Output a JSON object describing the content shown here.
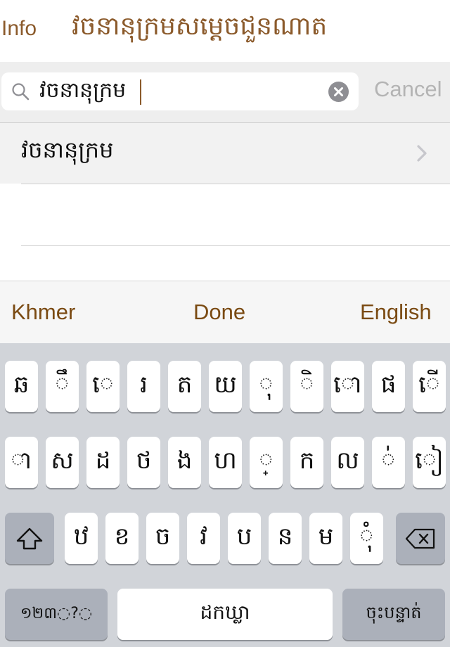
{
  "nav": {
    "info_label": "Info",
    "title": "វចនានុក្រមសម្ដេចជួនណាត"
  },
  "search": {
    "value": "វចនានុក្រម",
    "cancel_label": "Cancel"
  },
  "results": [
    {
      "label": "វចនានុក្រម"
    }
  ],
  "toolbar": {
    "left_label": "Khmer",
    "center_label": "Done",
    "right_label": "English"
  },
  "keyboard": {
    "row1": [
      "ឆ",
      "ឹ",
      "េ",
      "រ",
      "ត",
      "យ",
      "ុ",
      "ិ",
      "ោ",
      "ផ",
      "ើ"
    ],
    "row2": [
      "ា",
      "ស",
      "ដ",
      "ថ",
      "ង",
      "ហ",
      "្",
      "ក",
      "ល",
      "់",
      "ៀ"
    ],
    "row3": [
      "ឋ",
      "ខ",
      "ច",
      "វ",
      "ប",
      "ន",
      "ម",
      "ុំ"
    ],
    "numbers_label": "១២៣◌?◌",
    "space_label": "ដកឃ្លា",
    "return_label": "ចុះបន្ទាត់"
  },
  "colors": {
    "accent": "#8b5a2b",
    "keyboard_bg": "#d1d4d9",
    "cancel": "#b4b4b4"
  }
}
